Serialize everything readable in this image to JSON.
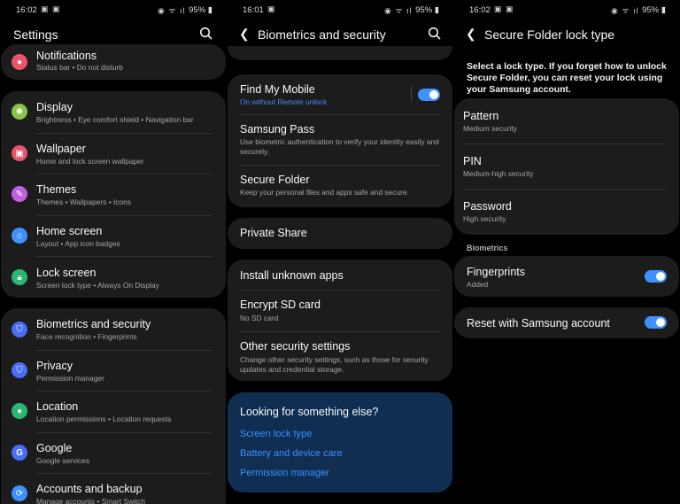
{
  "panel1": {
    "status": {
      "time": "16:02",
      "battery": "95%"
    },
    "title": "Settings",
    "rows": [
      {
        "title": "Notifications",
        "sub": "Status bar  •  Do not disturb"
      },
      {
        "title": "Display",
        "sub": "Brightness  •  Eye comfort shield  •  Navigation bar"
      },
      {
        "title": "Wallpaper",
        "sub": "Home and lock screen wallpaper"
      },
      {
        "title": "Themes",
        "sub": "Themes  •  Wallpapers  •  Icons"
      },
      {
        "title": "Home screen",
        "sub": "Layout  •  App icon badges"
      },
      {
        "title": "Lock screen",
        "sub": "Screen lock type  •  Always On Display"
      },
      {
        "title": "Biometrics and security",
        "sub": "Face recognition  •  Fingerprints"
      },
      {
        "title": "Privacy",
        "sub": "Permission manager"
      },
      {
        "title": "Location",
        "sub": "Location permissions  •  Location requests"
      },
      {
        "title": "Google",
        "sub": "Google services"
      },
      {
        "title": "Accounts and backup",
        "sub": "Manage accounts  •  Smart Switch"
      }
    ],
    "colors": [
      "#e8556a",
      "#8bc34a",
      "#e8556a",
      "#c060e0",
      "#3e91ff",
      "#2bb673",
      "#4a6cf7",
      "#4a6cf7",
      "#2bb673",
      "#4a6cf7",
      "#3e91ff"
    ]
  },
  "panel2": {
    "status": {
      "time": "16:01",
      "battery": "95%"
    },
    "title": "Biometrics and security",
    "find": {
      "title": "Find My Mobile",
      "sub": "On without Remote unlock"
    },
    "pass": {
      "title": "Samsung Pass",
      "sub": "Use biometric authentication to verify your identity easily and securely."
    },
    "folder": {
      "title": "Secure Folder",
      "sub": "Keep your personal files and apps safe and secure."
    },
    "share": {
      "title": "Private Share"
    },
    "unknown": {
      "title": "Install unknown apps"
    },
    "encrypt": {
      "title": "Encrypt SD card",
      "sub": "No SD card"
    },
    "other": {
      "title": "Other security settings",
      "sub": "Change other security settings, such as those for security updates and credential storage."
    },
    "looking": {
      "title": "Looking for something else?",
      "links": [
        "Screen lock type",
        "Battery and device care",
        "Permission manager"
      ]
    }
  },
  "panel3": {
    "status": {
      "time": "16:02",
      "battery": "95%"
    },
    "title": "Secure Folder lock type",
    "description": "Select a lock type. If you forget how to unlock Secure Folder, you can reset your lock using your Samsung account.",
    "options": [
      {
        "title": "Pattern",
        "sub": "Medium security"
      },
      {
        "title": "PIN",
        "sub": "Medium-high security"
      },
      {
        "title": "Password",
        "sub": "High security"
      }
    ],
    "biometrics_header": "Biometrics",
    "fingerprints": {
      "title": "Fingerprints",
      "sub": "Added"
    },
    "reset": {
      "title": "Reset with Samsung account"
    }
  }
}
